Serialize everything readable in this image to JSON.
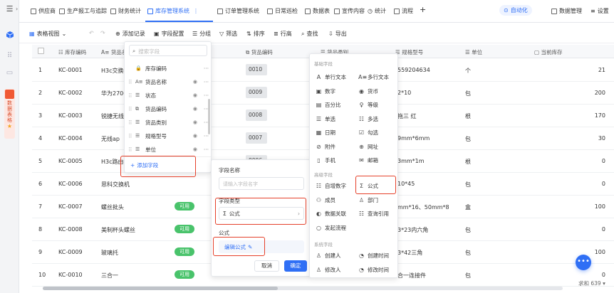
{
  "tabs": [
    {
      "label": "供应商",
      "active": false
    },
    {
      "label": "生产报工与追踪",
      "active": false
    },
    {
      "label": "财务统计",
      "active": false
    },
    {
      "label": "库存管理系统",
      "active": true
    },
    {
      "label": "订单管理系统",
      "active": false
    },
    {
      "label": "日常巡检",
      "active": false
    },
    {
      "label": "数据表",
      "active": false
    },
    {
      "label": "宣传内容",
      "active": false
    },
    {
      "label": "统计",
      "active": false
    },
    {
      "label": "流程",
      "active": false
    }
  ],
  "header_right": {
    "automation": "自动化",
    "data_manage": "数据管理",
    "settings": "设置"
  },
  "rail": {
    "app_label": "数据表格"
  },
  "toolbar": {
    "view": "表格视图",
    "add_record": "添加记录",
    "field_config": "字段配置",
    "group": "分组",
    "filter": "筛选",
    "sort": "排序",
    "row_height": "行高",
    "search": "查找",
    "export": "导出"
  },
  "columns": [
    "库存编码",
    "货品名",
    "货品编码",
    "货品类别",
    "规格型号",
    "单位",
    "当前库存"
  ],
  "rows": [
    {
      "n": "1",
      "code": "KC-0001",
      "name": "H3c交换机",
      "pcode": "0010",
      "spec": "559204634",
      "unit": "个",
      "stock": "21",
      "pill": ""
    },
    {
      "n": "2",
      "code": "KC-0002",
      "name": "华为2700",
      "pcode": "0009",
      "spec": "2*10",
      "unit": "包",
      "stock": "200",
      "pill": ""
    },
    {
      "n": "3",
      "code": "KC-0003",
      "name": "锐捷无线a",
      "pcode": "0008",
      "spec": "拖三 红",
      "unit": "根",
      "stock": "170",
      "pill": ""
    },
    {
      "n": "4",
      "code": "KC-0004",
      "name": "无线ap",
      "pcode": "0007",
      "spec": "9mm*6mm",
      "unit": "包",
      "stock": "30",
      "pill": ""
    },
    {
      "n": "5",
      "code": "KC-0005",
      "name": "H3c路由器",
      "pcode": "0006",
      "spec": "3mm*1m",
      "unit": "根",
      "stock": "0",
      "pill": ""
    },
    {
      "n": "6",
      "code": "KC-0006",
      "name": "思科交换机",
      "pcode": "",
      "spec": "10*45",
      "unit": "包",
      "stock": "0",
      "pill": ""
    },
    {
      "n": "7",
      "code": "KC-0007",
      "name": "螺丝批头",
      "pcode": "",
      "spec": "mm*16、50mm*8",
      "unit": "盒",
      "stock": "100",
      "pill": "可用"
    },
    {
      "n": "8",
      "code": "KC-0008",
      "name": "美制杯头螺丝",
      "pcode": "",
      "spec": "3*23内六角",
      "unit": "包",
      "stock": "0",
      "pill": "可用"
    },
    {
      "n": "9",
      "code": "KC-0009",
      "name": "玻璃托",
      "pcode": "",
      "spec": "3*42三角",
      "unit": "包",
      "stock": "100",
      "pill": "可用"
    },
    {
      "n": "10",
      "code": "KC-0010",
      "name": "三合一",
      "pcode": "",
      "spec": "合一连接件",
      "unit": "包",
      "stock": "0",
      "pill": "可用"
    }
  ],
  "field_panel": {
    "search_placeholder": "搜索字段",
    "items": [
      "库存编码",
      "货品名称",
      "状态",
      "货品编码",
      "货品类别",
      "规格型号",
      "单位"
    ],
    "add_field": "添加字段"
  },
  "config_panel": {
    "name_label": "字段名称",
    "name_placeholder": "请输入字段名字",
    "type_label": "字段类型",
    "type_value": "公式",
    "formula_label": "公式",
    "edit_formula": "编辑公式",
    "cancel": "取消",
    "confirm": "确定"
  },
  "type_panel": {
    "basic_title": "基础字段",
    "basic": [
      "单行文本",
      "多行文本",
      "数字",
      "货币",
      "百分比",
      "等级",
      "单选",
      "多选",
      "日期",
      "勾选",
      "附件",
      "网址",
      "手机",
      "邮箱"
    ],
    "advanced_title": "高级字段",
    "advanced": [
      "自增数字",
      "公式",
      "成员",
      "部门",
      "数据关联",
      "查询引用",
      "发起流程"
    ],
    "system_title": "系统字段",
    "system": [
      "创建人",
      "创建时间",
      "修改人",
      "修改时间"
    ]
  },
  "footer": {
    "total": "求和 639"
  }
}
